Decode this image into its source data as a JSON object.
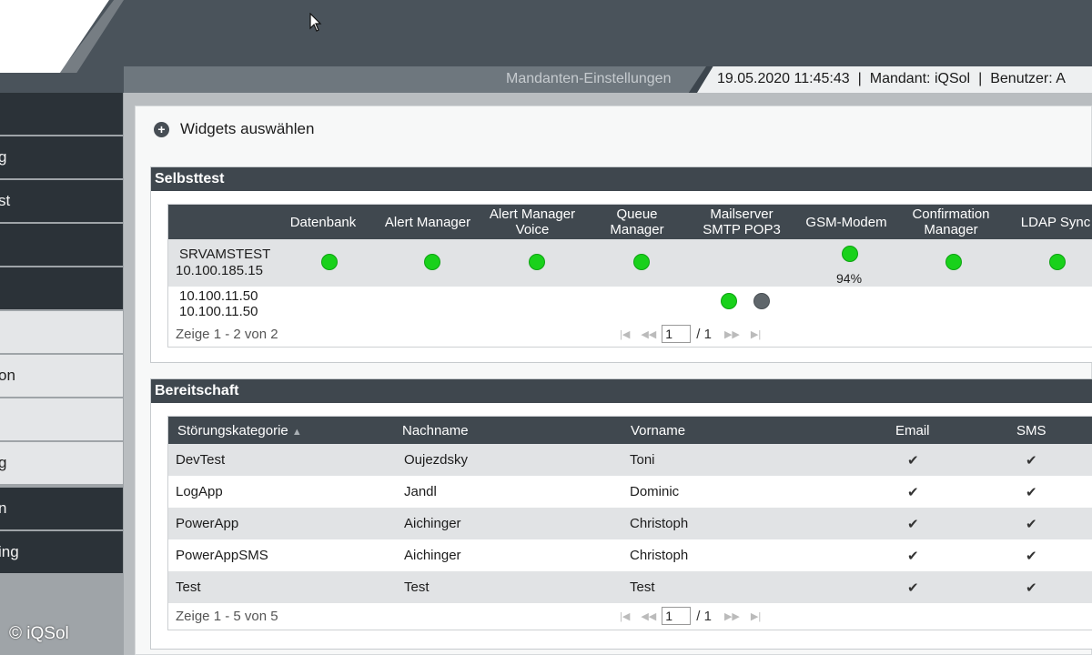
{
  "header": {
    "context_title": "Mandanten-Einstellungen",
    "datetime": "19.05.2020 11:45:43",
    "separator": "|",
    "mandant": "Mandant: iQSol",
    "user": "Benutzer: A"
  },
  "sidebar": {
    "items": [
      {
        "label": ""
      },
      {
        "label": "g"
      },
      {
        "label": "st"
      },
      {
        "label": ""
      },
      {
        "label": ""
      },
      {
        "label": ""
      },
      {
        "label": "on"
      },
      {
        "label": ""
      },
      {
        "label": "g"
      },
      {
        "label": "n"
      },
      {
        "label": "ing"
      }
    ]
  },
  "watermark": "© iQSol",
  "widgets": {
    "label": "Widgets auswählen",
    "icon": "plus-circle-icon"
  },
  "selbsttest": {
    "title": "Selbsttest",
    "columns": [
      "Datenbank",
      "Alert Manager",
      "Alert Manager Voice",
      "Queue Manager",
      "Mailserver SMTP POP3",
      "GSM-Modem",
      "Confirmation Manager",
      "LDAP Sync"
    ],
    "rows": [
      {
        "host_name": "SRVAMSTEST",
        "host_ip": "10.100.185.15",
        "status": [
          "ok",
          "ok",
          "ok",
          "ok",
          "",
          "ok",
          "ok",
          "ok"
        ],
        "gsm_percent": "94%"
      },
      {
        "host_name": "10.100.11.50",
        "host_ip": "10.100.11.50",
        "status": [
          "",
          "",
          "",
          "",
          "ok off",
          "",
          "",
          ""
        ]
      }
    ],
    "pager": {
      "info": "Zeige 1 - 2 von 2",
      "page": "1",
      "total": "/ 1"
    }
  },
  "bereitschaft": {
    "title": "Bereitschaft",
    "columns": [
      "Störungskategorie",
      "Nachname",
      "Vorname",
      "Email",
      "SMS"
    ],
    "sort_icon": "sort-asc-icon",
    "rows": [
      {
        "kategorie": "DevTest",
        "nachname": "Oujezdsky",
        "vorname": "Toni",
        "email": "✔",
        "sms": "✔"
      },
      {
        "kategorie": "LogApp",
        "nachname": "Jandl",
        "vorname": "Dominic",
        "email": "✔",
        "sms": "✔"
      },
      {
        "kategorie": "PowerApp",
        "nachname": "Aichinger",
        "vorname": "Christoph",
        "email": "✔",
        "sms": "✔"
      },
      {
        "kategorie": "PowerAppSMS",
        "nachname": "Aichinger",
        "vorname": "Christoph",
        "email": "✔",
        "sms": "✔"
      },
      {
        "kategorie": "Test",
        "nachname": "Test",
        "vorname": "Test",
        "email": "✔",
        "sms": "✔"
      }
    ],
    "pager": {
      "info": "Zeige 1 - 5 von 5",
      "page": "1",
      "total": "/ 1"
    }
  },
  "colors": {
    "ok": "#19d11b",
    "off": "#5f666b",
    "header_dark": "#40484f"
  }
}
